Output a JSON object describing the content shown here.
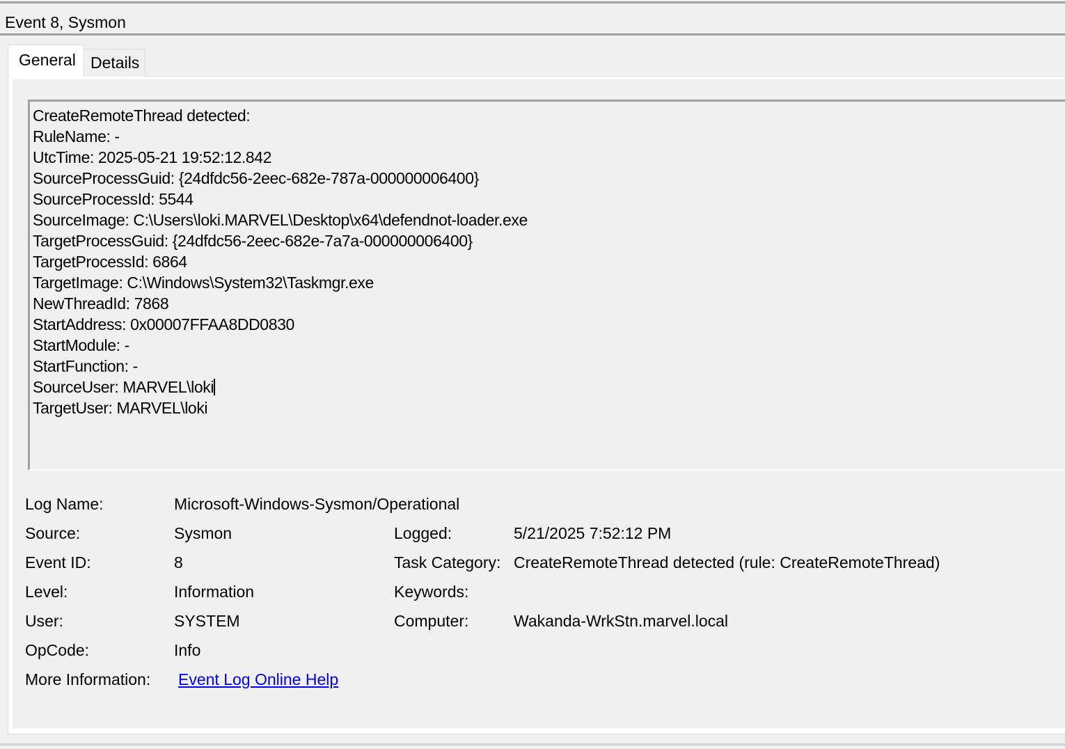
{
  "window": {
    "title": "Event 8, Sysmon"
  },
  "tabs": [
    {
      "label": "General",
      "selected": true
    },
    {
      "label": "Details",
      "selected": false
    }
  ],
  "description": {
    "lines": [
      "CreateRemoteThread detected:",
      "RuleName: -",
      "UtcTime: 2025-05-21 19:52:12.842",
      "SourceProcessGuid: {24dfdc56-2eec-682e-787a-000000006400}",
      "SourceProcessId: 5544",
      "SourceImage: C:\\Users\\loki.MARVEL\\Desktop\\x64\\defendnot-loader.exe",
      "TargetProcessGuid: {24dfdc56-2eec-682e-7a7a-000000006400}",
      "TargetProcessId: 6864",
      "TargetImage: C:\\Windows\\System32\\Taskmgr.exe",
      "NewThreadId: 7868",
      "StartAddress: 0x00007FFAA8DD0830",
      "StartModule: -",
      "StartFunction: -",
      "SourceUser: MARVEL\\loki",
      "TargetUser: MARVEL\\loki"
    ]
  },
  "properties": {
    "log_name": {
      "label": "Log Name:",
      "value": "Microsoft-Windows-Sysmon/Operational"
    },
    "source": {
      "label": "Source:",
      "value": "Sysmon"
    },
    "logged": {
      "label": "Logged:",
      "value": "5/21/2025 7:52:12 PM"
    },
    "event_id": {
      "label": "Event ID:",
      "value": "8"
    },
    "task_category": {
      "label": "Task Category:",
      "value": "CreateRemoteThread detected (rule: CreateRemoteThread)"
    },
    "level": {
      "label": "Level:",
      "value": "Information"
    },
    "keywords": {
      "label": "Keywords:",
      "value": ""
    },
    "user": {
      "label": "User:",
      "value": "SYSTEM"
    },
    "computer": {
      "label": "Computer:",
      "value": "Wakanda-WrkStn.marvel.local"
    },
    "opcode": {
      "label": "OpCode:",
      "value": "Info"
    },
    "more_info": {
      "label": "More Information:",
      "link_text": "Event Log Online Help"
    }
  },
  "colors": {
    "window_bg": "#f0f0f0",
    "link": "#0000ee",
    "border": "#a0a0a0"
  }
}
